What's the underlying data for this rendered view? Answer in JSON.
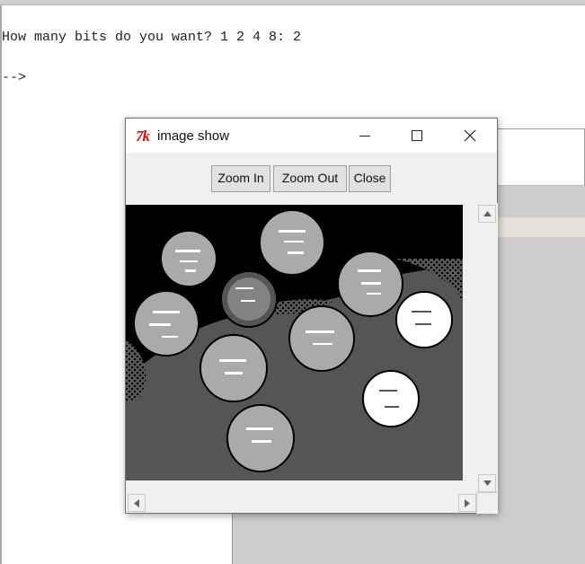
{
  "console": {
    "prompt_line": "How many bits do you want? 1 2 4 8: 2",
    "cursor_line": "-->"
  },
  "window": {
    "icon_text": "7k",
    "title": "image show"
  },
  "toolbar": {
    "zoom_in_label": "Zoom In",
    "zoom_out_label": "Zoom Out",
    "close_label": "Close"
  },
  "icons": {
    "app_icon": "tk-feather-icon",
    "minimize": "minimize-icon",
    "maximize": "maximize-icon",
    "close": "close-icon"
  },
  "image": {
    "description_colors": {
      "dark": "#000000",
      "mid": "#555555",
      "light": "#aaaaaa",
      "bright": "#ffffff"
    }
  }
}
